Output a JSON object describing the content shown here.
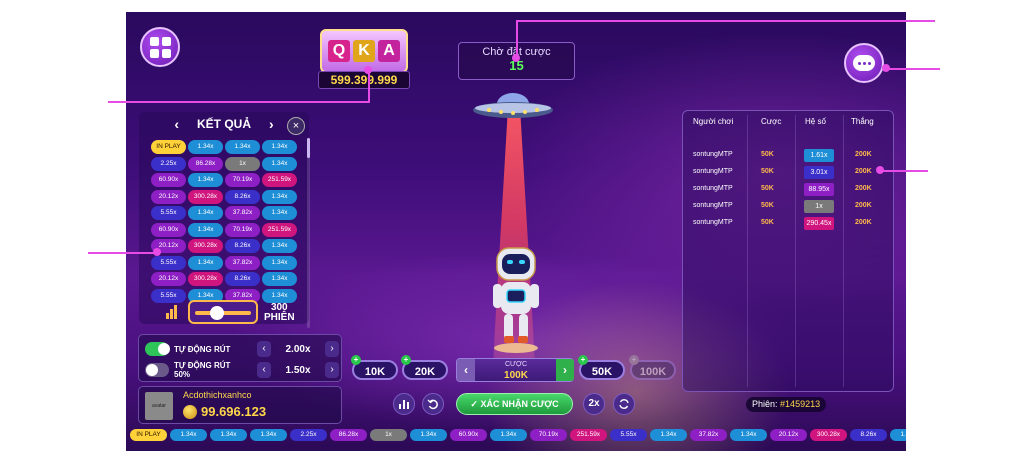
{
  "slot": {
    "reels": [
      "Q",
      "K",
      "A"
    ],
    "balance": "599.399.999"
  },
  "wait": {
    "label": "Chờ đặt cược",
    "value": "15"
  },
  "results": {
    "title": "KẾT QUẢ",
    "prev": "‹",
    "next": "›",
    "close": "×",
    "rows": [
      [
        "IN PLAY",
        "1.34x",
        "1.34x",
        "1.34x"
      ],
      [
        "2.25x",
        "86.28x",
        "1x",
        "1.34x"
      ],
      [
        "60.90x",
        "1.34x",
        "70.19x",
        "251.59x"
      ],
      [
        "20.12x",
        "300.28x",
        "8.26x",
        "1.34x"
      ],
      [
        "5.55x",
        "1.34x",
        "37.82x",
        "1.34x"
      ],
      [
        "60.90x",
        "1.34x",
        "70.19x",
        "251.59x"
      ],
      [
        "20.12x",
        "300.28x",
        "8.26x",
        "1.34x"
      ],
      [
        "5.55x",
        "1.34x",
        "37.82x",
        "1.34x"
      ],
      [
        "20.12x",
        "300.28x",
        "8.26x",
        "1.34x"
      ],
      [
        "5.55x",
        "1.34x",
        "37.82x",
        "1.34x"
      ]
    ]
  },
  "sessions": {
    "count": "300",
    "unit": "PHIÊN",
    "level": 0.35
  },
  "auto": {
    "rows": [
      {
        "label": "TỰ ĐỘNG RÚT",
        "value": "2.00x",
        "on": true
      },
      {
        "label": "TỰ ĐỘNG RÚT 50%",
        "value": "1.50x",
        "on": false
      }
    ],
    "dec": "‹",
    "inc": "›"
  },
  "user": {
    "avatar_text": "avatar",
    "name": "Acdothichxanhco",
    "balance": "99.696.123"
  },
  "chips": [
    "10K",
    "20K",
    "50K",
    "100K"
  ],
  "bet": {
    "label": "CƯỢC",
    "value": "100K",
    "dec": "‹",
    "inc": "›"
  },
  "actions": {
    "confirm": "XÁC NHẬN CƯỢC",
    "double": "2x"
  },
  "players": {
    "headers": [
      "Người chơi",
      "Cược",
      "Hệ số",
      "Thắng"
    ],
    "rows": [
      {
        "name": "sontungMTP",
        "bet": "50K",
        "mult": "1.61x",
        "win": "200K"
      },
      {
        "name": "sontungMTP",
        "bet": "50K",
        "mult": "3.01x",
        "win": "200K"
      },
      {
        "name": "sontungMTP",
        "bet": "50K",
        "mult": "88.95x",
        "win": "200K"
      },
      {
        "name": "sontungMTP",
        "bet": "50K",
        "mult": "1x",
        "win": "200K"
      },
      {
        "name": "sontungMTP",
        "bet": "50K",
        "mult": "290.45x",
        "win": "200K"
      }
    ]
  },
  "round": {
    "label": "Phiên:",
    "id": "#1459213"
  },
  "ticker": [
    "IN PLAY",
    "1.34x",
    "1.34x",
    "1.34x",
    "2.25x",
    "86.28x",
    "1x",
    "1.34x",
    "60.90x",
    "1.34x",
    "70.19x",
    "251.59x",
    "5.55x",
    "1.34x",
    "37.82x",
    "1.34x",
    "20.12x",
    "300.28x",
    "8.26x",
    "1.34x",
    "1.34x"
  ],
  "colors": {
    "low": "#1e8fd6",
    "mid": "#3b2fc9",
    "high": "#8d1fc4",
    "top": "#d0157e",
    "one": "#7a7a7a",
    "inplay": "#ffd23a",
    "accent": "#e64be6"
  }
}
